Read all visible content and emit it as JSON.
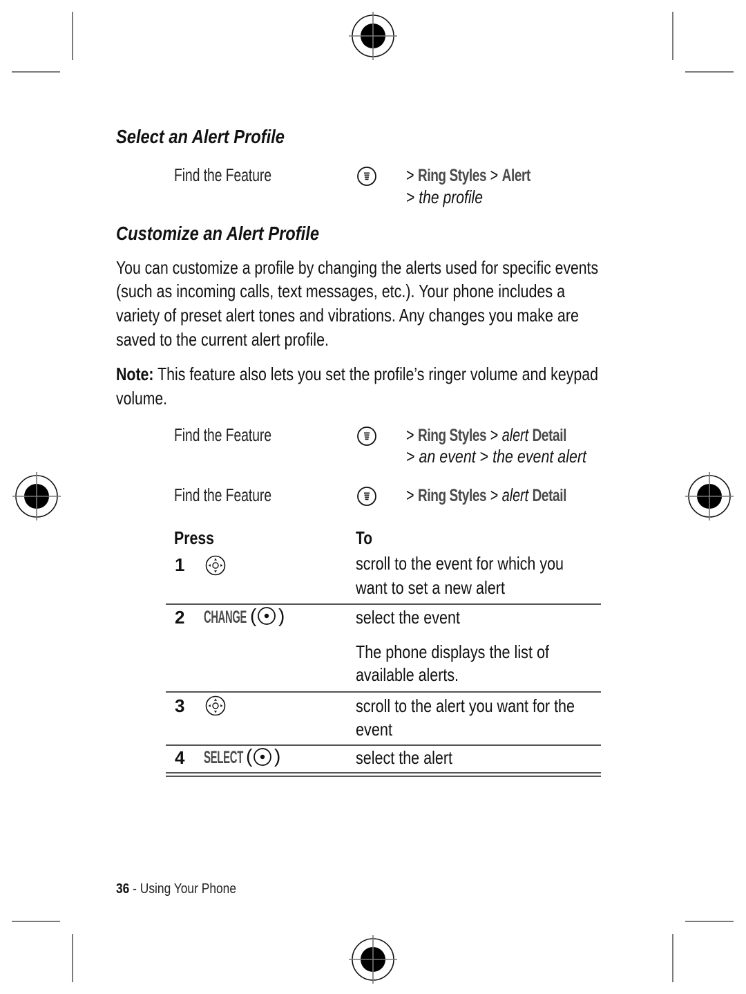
{
  "theme": {
    "text_color": "#111111",
    "key_label_color": "#4a4a4a",
    "rule_color": "#555555",
    "crop_mark_color": "#7a7a7a"
  },
  "select_profile": {
    "heading": "Select an Alert Profile",
    "find_feature": {
      "label": "Find the Feature",
      "key_icon": "menu-key-icon",
      "path_line1": {
        "sep1": ">",
        "item1": "Ring Styles",
        "sep2": ">",
        "item2": "Alert"
      },
      "path_line2": {
        "sep1": ">",
        "item1": "the profile"
      }
    }
  },
  "customize_profile": {
    "heading": "Customize an Alert Profile",
    "intro_lines": [
      "You can customize a profile by changing the alerts used for specific events",
      "(such as incoming calls, text messages, etc.). Your phone includes a",
      "variety of preset alert tones and vibrations. Any changes you make are",
      "saved to the current alert profile."
    ],
    "note": {
      "label": "Note:",
      "lines": [
        "This feature also lets you set the profile’s ringer volume and keypad",
        "volume."
      ]
    },
    "find_feature_event_alert": {
      "label": "Find the Feature",
      "key_icon": "menu-key-icon",
      "path_line1": {
        "sep1": ">",
        "item1": "Ring Styles",
        "sep2": ">",
        "item2_italic": "alert",
        "item2_key": "Detail"
      },
      "path_line2": {
        "sep1": ">",
        "item1": "an event",
        "sep2": ">",
        "item2": "the event alert"
      }
    },
    "find_feature_detail": {
      "label": "Find the Feature",
      "key_icon": "menu-key-icon",
      "path_line1": {
        "sep1": ">",
        "item1": "Ring Styles",
        "sep2": ">",
        "item2_italic": "alert",
        "item2_key": "Detail"
      }
    }
  },
  "steps_table": {
    "headers": {
      "press": "Press",
      "to": "To"
    },
    "rows": [
      {
        "step": "1",
        "key_icon": "nav-key-icon",
        "action_lines": [
          "scroll to the event for which you",
          "want to set a new alert"
        ]
      },
      {
        "step": "2",
        "key_label": "CHANGE",
        "paren_open": "(",
        "key_icon": "center-select-key-icon",
        "paren_close": ")",
        "action_lines": [
          "select the event"
        ],
        "result_lines": [
          "The phone displays the list of",
          "available alerts."
        ]
      },
      {
        "step": "3",
        "key_icon": "nav-key-icon",
        "action_lines": [
          "scroll to the alert you want for the",
          "event"
        ]
      },
      {
        "step": "4",
        "key_label": "SELECT",
        "paren_open": "(",
        "key_icon": "center-select-key-icon",
        "paren_close": ")",
        "action_lines": [
          "select the alert"
        ]
      }
    ]
  },
  "footer": {
    "page_number": "36",
    "separator": "-",
    "section_title": "Using Your Phone"
  }
}
